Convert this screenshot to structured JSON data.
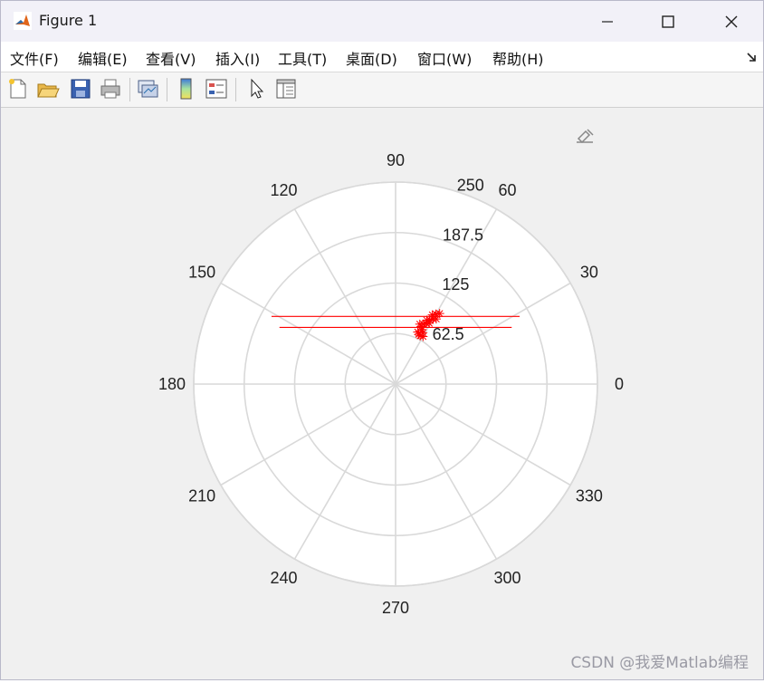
{
  "window": {
    "title": "Figure 1"
  },
  "menu": [
    "文件(F)",
    "编辑(E)",
    "查看(V)",
    "插入(I)",
    "工具(T)",
    "桌面(D)",
    "窗口(W)",
    "帮助(H)"
  ],
  "toolbar": {
    "icons": [
      "new-figure-icon",
      "open-file-icon",
      "save-icon",
      "print-icon",
      "link-plot-icon",
      "colorbar-icon",
      "legend-icon",
      "edit-plot-arrow-icon",
      "property-inspector-icon"
    ]
  },
  "watermark": "CSDN @我爱Matlab编程",
  "colors": {
    "trace": "#ff0000",
    "grid": "#d9d9d9",
    "plot_bg": "#ffffff",
    "figure_bg": "#f0f0f0"
  },
  "chart_data": {
    "type": "polar",
    "angle_ticks": [
      "0",
      "30",
      "60",
      "90",
      "120",
      "150",
      "180",
      "210",
      "240",
      "270",
      "300",
      "330"
    ],
    "radial_ticks": [
      "62.5",
      "125",
      "187.5",
      "250"
    ],
    "rlim": [
      0,
      250
    ],
    "grid": true,
    "series": [
      {
        "marker": "*",
        "color": "#ff0000",
        "line_style": "solid",
        "points_theta_r": [
          [
            60,
            68
          ],
          [
            63,
            67
          ],
          [
            65,
            68
          ],
          [
            67,
            70
          ],
          [
            62,
            72
          ],
          [
            64,
            75
          ],
          [
            66,
            78
          ],
          [
            68,
            80
          ],
          [
            65,
            82
          ],
          [
            63,
            84
          ],
          [
            61,
            86
          ],
          [
            64,
            88
          ],
          [
            62,
            90
          ],
          [
            60,
            93
          ],
          [
            58,
            95
          ],
          [
            62,
            97
          ],
          [
            60,
            100
          ],
          [
            58,
            103
          ]
        ],
        "lines_theta_r": [
          [
            [
              28.6,
              175
            ],
            [
              151.4,
              175
            ]
          ],
          [
            [
              26,
              160
            ],
            [
              154,
              160
            ]
          ]
        ]
      }
    ]
  }
}
